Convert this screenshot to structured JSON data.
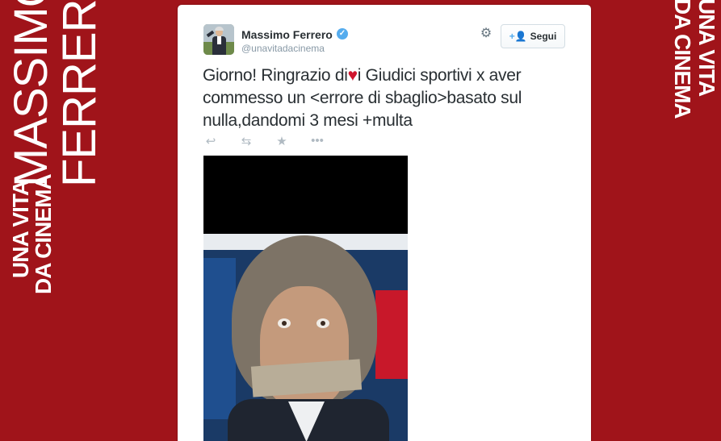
{
  "background": {
    "brand_color": "#a0141a",
    "left_lines": [
      "UNA VITA",
      "DA CINEMA",
      "MASSIMO",
      "FERRERO"
    ],
    "right_lines": [
      "UNA VITA",
      "DA CINEMA"
    ]
  },
  "tweet": {
    "user": {
      "name": "Massimo Ferrero",
      "handle": "@unavitadacinema",
      "verified_icon": "verified-check-icon"
    },
    "follow_button": {
      "label": "Segui",
      "icon": "follow-user-icon"
    },
    "text_before_heart": "Giorno! Ringrazio di",
    "text_after_heart": "i Giudici sportivi x aver commesso un <errore di sbaglio>basato sul nulla,dandomi 3 mesi +multa",
    "actions": [
      {
        "name": "reply-icon",
        "glyph": "↩"
      },
      {
        "name": "retweet-icon",
        "glyph": "⇆"
      },
      {
        "name": "favorite-icon",
        "glyph": "★"
      },
      {
        "name": "more-icon",
        "glyph": "•••"
      }
    ]
  }
}
